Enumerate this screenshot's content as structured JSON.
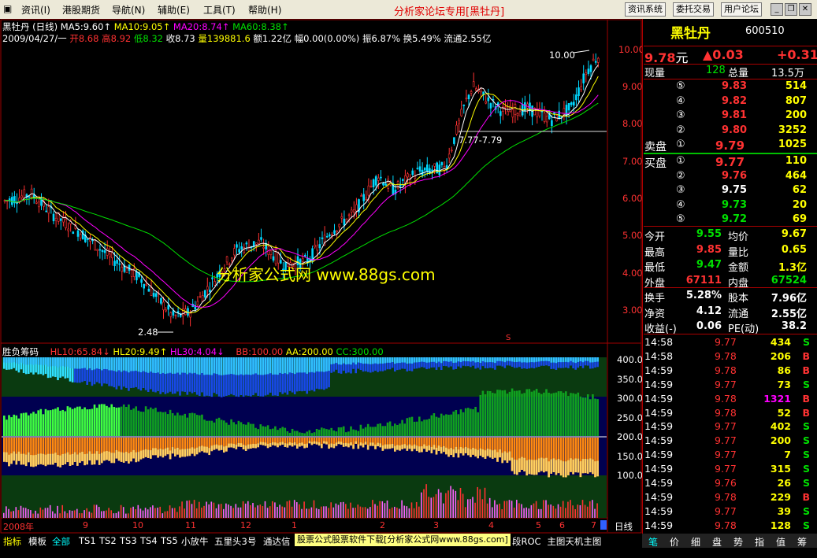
{
  "menu": {
    "items": [
      "资讯(I)",
      "港股期货",
      "导航(N)",
      "辅助(E)",
      "工具(T)",
      "帮助(H)"
    ],
    "app_title": "分析家论坛专用[黑牡丹]",
    "top_buttons": [
      "资讯系统",
      "委托交易",
      "用户论坛"
    ]
  },
  "info": {
    "stock_period": "黑牡丹 (日线)",
    "ma5": "MA5:9.60↑",
    "ma10": "MA10:9.05↑",
    "ma20": "MA20:8.74↑",
    "ma60": "MA60:8.38↑",
    "date_line": "2009/04/27/一",
    "open": "开8.68",
    "high": "高8.92",
    "low": "低8.32",
    "close": "收8.73",
    "vol": "量139881.6",
    "amount": "额1.22亿",
    "range": "幅0.00(0.00%)",
    "amp": "振6.87%",
    "turnover": "换5.49%",
    "float": "流通2.55亿"
  },
  "price_axis": [
    "10.00",
    "9.00",
    "8.00",
    "7.00",
    "6.00",
    "5.00",
    "4.00",
    "3.00"
  ],
  "annotations": {
    "high_marker": "10.00",
    "low_marker": "2.48",
    "level_label": "7.77-7.79",
    "watermark": "分析家公式网 www.88gs.com",
    "s_mark": "S"
  },
  "indicator": {
    "name": "胜负筹码",
    "hl10": "HL10:65.84↓",
    "hl20": "HL20:9.49↑",
    "hl30": "HL30:4.04↓",
    "bb": "BB:100.00",
    "aa": "AA:200.00",
    "cc": "CC:300.00",
    "axis": [
      "400.0",
      "350.0",
      "300.0",
      "250.0",
      "200.0",
      "150.0",
      "100.0"
    ]
  },
  "time_axis": [
    "2008年",
    "9",
    "10",
    "11",
    "12",
    "1",
    "2",
    "3",
    "4",
    "5",
    "6",
    "7"
  ],
  "period_label": "日线",
  "bottom_tabs": [
    "指标",
    "模板",
    "全部",
    "TS1",
    "TS2",
    "TS3",
    "TS4",
    "TS5",
    "小放牛",
    "五里头3号",
    "通达信"
  ],
  "bottom_tabs_right": [
    "段ROC",
    "主图天机主图"
  ],
  "bottom_ad": "股票公式股票软件下载[分析家公式网www.88gs.com]",
  "right": {
    "name": "黑牡丹",
    "code": "600510",
    "price": "9.78",
    "price_unit": "元",
    "change": "▲0.03",
    "change_pct": "+0.31",
    "now_vol_label": "现量",
    "now_vol": "128",
    "total_vol_label": "总量",
    "total_vol": "13.5万",
    "sell_label": "卖盘",
    "buy_label": "买盘",
    "asks": [
      {
        "level": "⑤",
        "price": "9.83",
        "vol": "514"
      },
      {
        "level": "④",
        "price": "9.82",
        "vol": "807"
      },
      {
        "level": "③",
        "price": "9.81",
        "vol": "200"
      },
      {
        "level": "②",
        "price": "9.80",
        "vol": "3252"
      },
      {
        "level": "①",
        "price": "9.79",
        "vol": "1025"
      }
    ],
    "bids": [
      {
        "level": "①",
        "price": "9.77",
        "vol": "110"
      },
      {
        "level": "②",
        "price": "9.76",
        "vol": "464"
      },
      {
        "level": "③",
        "price": "9.75",
        "vol": "62"
      },
      {
        "level": "④",
        "price": "9.73",
        "vol": "20"
      },
      {
        "level": "⑤",
        "price": "9.72",
        "vol": "69"
      }
    ],
    "stats": [
      {
        "l1": "今开",
        "v1": "9.55",
        "l2": "均价",
        "v2": "9.67"
      },
      {
        "l1": "最高",
        "v1": "9.85",
        "l2": "量比",
        "v2": "0.65"
      },
      {
        "l1": "最低",
        "v1": "9.47",
        "l2": "金额",
        "v2": "1.3亿"
      },
      {
        "l1": "外盘",
        "v1": "67111",
        "l2": "内盘",
        "v2": "67524"
      }
    ],
    "stats2": [
      {
        "l1": "换手",
        "v1": "5.28%",
        "l2": "股本",
        "v2": "7.96亿"
      },
      {
        "l1": "净资",
        "v1": "4.12",
        "l2": "流通",
        "v2": "2.55亿"
      },
      {
        "l1": "收益(-)",
        "v1": "0.06",
        "l2": "PE(动)",
        "v2": "38.2"
      }
    ],
    "ticks": [
      {
        "t": "14:58",
        "p": "9.77",
        "v": "434",
        "s": "S"
      },
      {
        "t": "14:58",
        "p": "9.78",
        "v": "206",
        "s": "B"
      },
      {
        "t": "14:59",
        "p": "9.78",
        "v": "86",
        "s": "B"
      },
      {
        "t": "14:59",
        "p": "9.77",
        "v": "73",
        "s": "S"
      },
      {
        "t": "14:59",
        "p": "9.78",
        "v": "1321",
        "s": "B"
      },
      {
        "t": "14:59",
        "p": "9.78",
        "v": "52",
        "s": "B"
      },
      {
        "t": "14:59",
        "p": "9.77",
        "v": "402",
        "s": "S"
      },
      {
        "t": "14:59",
        "p": "9.77",
        "v": "200",
        "s": "S"
      },
      {
        "t": "14:59",
        "p": "9.77",
        "v": "7",
        "s": "S"
      },
      {
        "t": "14:59",
        "p": "9.77",
        "v": "315",
        "s": "S"
      },
      {
        "t": "14:59",
        "p": "9.76",
        "v": "26",
        "s": "S"
      },
      {
        "t": "14:59",
        "p": "9.78",
        "v": "229",
        "s": "B"
      },
      {
        "t": "14:59",
        "p": "9.77",
        "v": "39",
        "s": "S"
      },
      {
        "t": "14:59",
        "p": "9.78",
        "v": "128",
        "s": "S"
      }
    ],
    "bottom_tabs": [
      "笔",
      "价",
      "细",
      "盘",
      "势",
      "指",
      "值",
      "筹"
    ]
  },
  "colors": {
    "up": "#ff3232",
    "down": "#00e000",
    "ma5": "#ffffff",
    "ma10": "#ffff00",
    "ma20": "#ff00ff",
    "ma60": "#00e000",
    "border": "#a00000"
  }
}
